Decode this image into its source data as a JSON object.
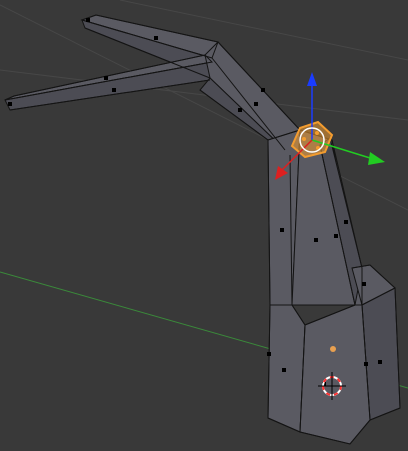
{
  "app": "3D Viewport",
  "viewport": {
    "background_color": "#393939",
    "grid_line_color": "#474747",
    "x_axis_line_color": "#3a8a3a"
  },
  "mesh": {
    "face_color": "#5a5a62",
    "face_dark_color": "#4c4c54",
    "edge_color": "#141414",
    "vertex_color": "#000000",
    "selected_color": "#f39c2f"
  },
  "gizmo": {
    "z_color": "#1a3cff",
    "y_color": "#22cc22",
    "x_color": "#dd2020",
    "center_color": "#ffffff"
  },
  "cursor": {
    "ring_color_a": "#ff3030",
    "ring_color_b": "#ffffff",
    "crosshair_color": "#000000"
  },
  "origin_dot_color": "#e8a050"
}
